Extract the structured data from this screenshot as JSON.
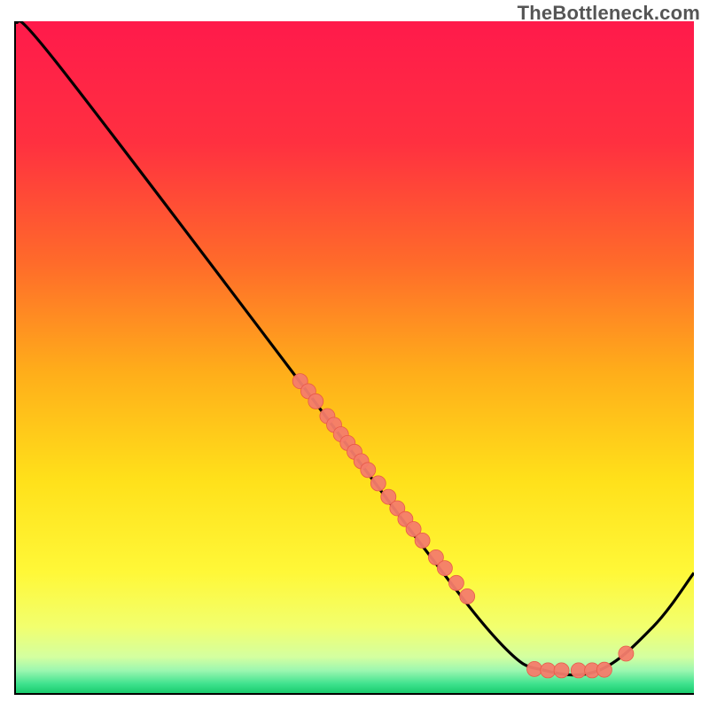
{
  "watermark_text": "TheBottleneck.com",
  "chart_data": {
    "type": "line",
    "title": "",
    "xlabel": "",
    "ylabel": "",
    "xlim": [
      0,
      100
    ],
    "ylim": [
      0,
      100
    ],
    "curve": [
      {
        "x": 0,
        "y": 100
      },
      {
        "x": 6,
        "y": 94
      },
      {
        "x": 40,
        "y": 49
      },
      {
        "x": 60,
        "y": 22
      },
      {
        "x": 72,
        "y": 7
      },
      {
        "x": 78,
        "y": 3.5
      },
      {
        "x": 86,
        "y": 3.5
      },
      {
        "x": 94,
        "y": 10
      },
      {
        "x": 100,
        "y": 18
      }
    ],
    "points": [
      {
        "x": 42.0,
        "y": 46.5
      },
      {
        "x": 43.2,
        "y": 45.0
      },
      {
        "x": 44.3,
        "y": 43.5
      },
      {
        "x": 46.0,
        "y": 41.3
      },
      {
        "x": 47.0,
        "y": 40.0
      },
      {
        "x": 48.0,
        "y": 38.6
      },
      {
        "x": 49.0,
        "y": 37.3
      },
      {
        "x": 50.0,
        "y": 36.0
      },
      {
        "x": 51.0,
        "y": 34.6
      },
      {
        "x": 52.0,
        "y": 33.3
      },
      {
        "x": 53.5,
        "y": 31.3
      },
      {
        "x": 55.0,
        "y": 29.3
      },
      {
        "x": 56.3,
        "y": 27.6
      },
      {
        "x": 57.5,
        "y": 26.0
      },
      {
        "x": 58.7,
        "y": 24.5
      },
      {
        "x": 60.0,
        "y": 22.8
      },
      {
        "x": 62.0,
        "y": 20.3
      },
      {
        "x": 63.3,
        "y": 18.7
      },
      {
        "x": 65.0,
        "y": 16.5
      },
      {
        "x": 66.6,
        "y": 14.5
      },
      {
        "x": 76.5,
        "y": 3.7
      },
      {
        "x": 78.5,
        "y": 3.5
      },
      {
        "x": 80.5,
        "y": 3.5
      },
      {
        "x": 83.0,
        "y": 3.5
      },
      {
        "x": 85.0,
        "y": 3.5
      },
      {
        "x": 86.8,
        "y": 3.6
      },
      {
        "x": 90.0,
        "y": 6.0
      }
    ],
    "gradient_stops": [
      {
        "offset": 0.0,
        "color": "#ff1a4b"
      },
      {
        "offset": 0.18,
        "color": "#ff3040"
      },
      {
        "offset": 0.36,
        "color": "#ff6b2a"
      },
      {
        "offset": 0.52,
        "color": "#ffad1a"
      },
      {
        "offset": 0.68,
        "color": "#ffe01a"
      },
      {
        "offset": 0.82,
        "color": "#fff838"
      },
      {
        "offset": 0.9,
        "color": "#f2ff6e"
      },
      {
        "offset": 0.945,
        "color": "#d4ffa0"
      },
      {
        "offset": 0.965,
        "color": "#9cf7b0"
      },
      {
        "offset": 0.985,
        "color": "#3fe28e"
      },
      {
        "offset": 1.0,
        "color": "#15c96a"
      }
    ],
    "point_fill": "#f47c6c",
    "point_stroke": "#e85a48",
    "curve_stroke": "#000000"
  }
}
